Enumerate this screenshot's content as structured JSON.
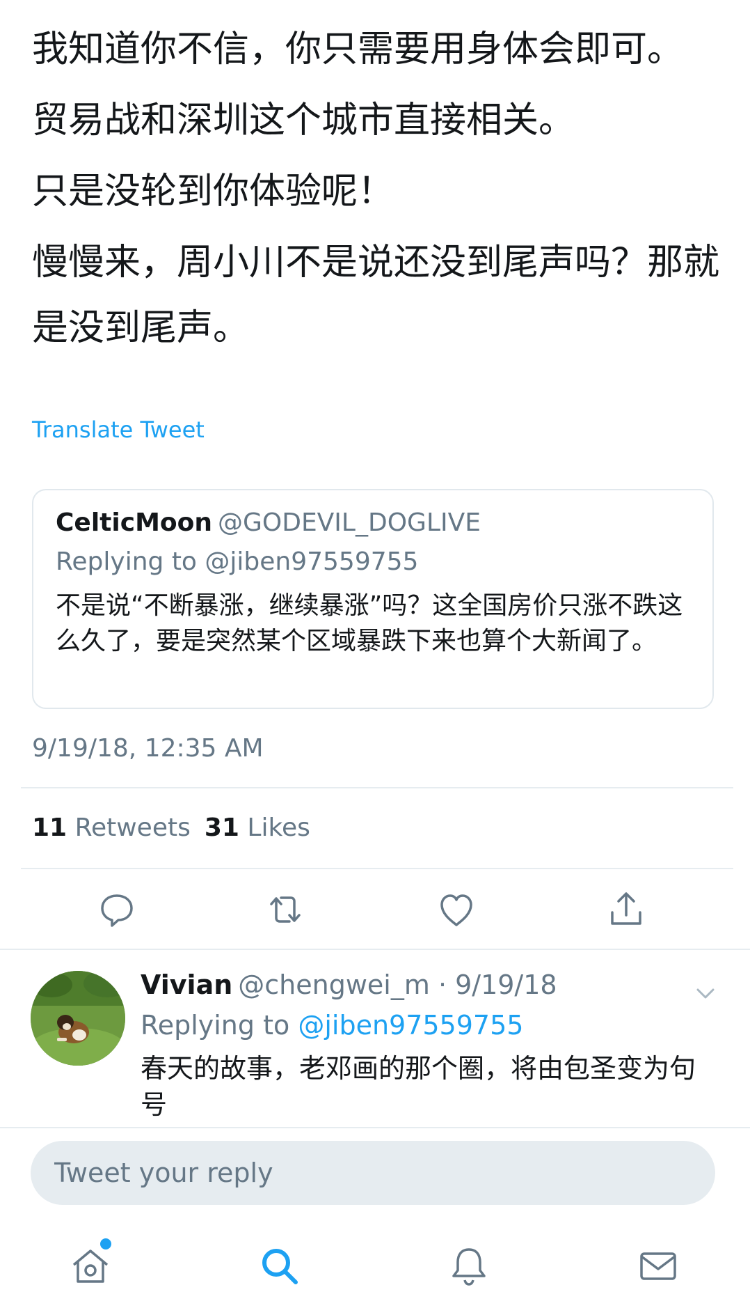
{
  "tweet": {
    "lines": [
      "我知道你不信，你只需要用身体会即可。",
      "贸易战和深圳这个城市直接相关。",
      "只是没轮到你体验呢！",
      "慢慢来，周小川不是说还没到尾声吗？那就是没到尾声。"
    ],
    "translate_label": "Translate Tweet",
    "timestamp": "9/19/18, 12:35 AM"
  },
  "quote": {
    "name": "CelticMoon",
    "handle": "@GODEVIL_DOGLIVE",
    "replying_to": "Replying to @jiben97559755",
    "text": "不是说“不断暴涨，继续暴涨”吗？这全国房价只涨不跌这么久了，要是突然某个区域暴跌下来也算个大新闻了。"
  },
  "stats": {
    "retweets_count": "11",
    "retweets_label": "Retweets",
    "likes_count": "31",
    "likes_label": "Likes"
  },
  "actions": {
    "reply_icon": "reply-icon",
    "retweet_icon": "retweet-icon",
    "like_icon": "heart-icon",
    "share_icon": "share-icon"
  },
  "reply": {
    "name": "Vivian",
    "meta": "@chengwei_m · 9/19/18",
    "replying_prefix": "Replying to",
    "mention": "@jiben97559755",
    "text": "春天的故事，老邓画的那个圈，将由包圣变为句号"
  },
  "compose": {
    "placeholder": "Tweet your reply"
  },
  "tabs": [
    "home-icon",
    "search-icon",
    "notifications-icon",
    "messages-icon"
  ],
  "colors": {
    "accent": "#1da1f2",
    "muted": "#657786",
    "divider": "#e6ecf0"
  }
}
